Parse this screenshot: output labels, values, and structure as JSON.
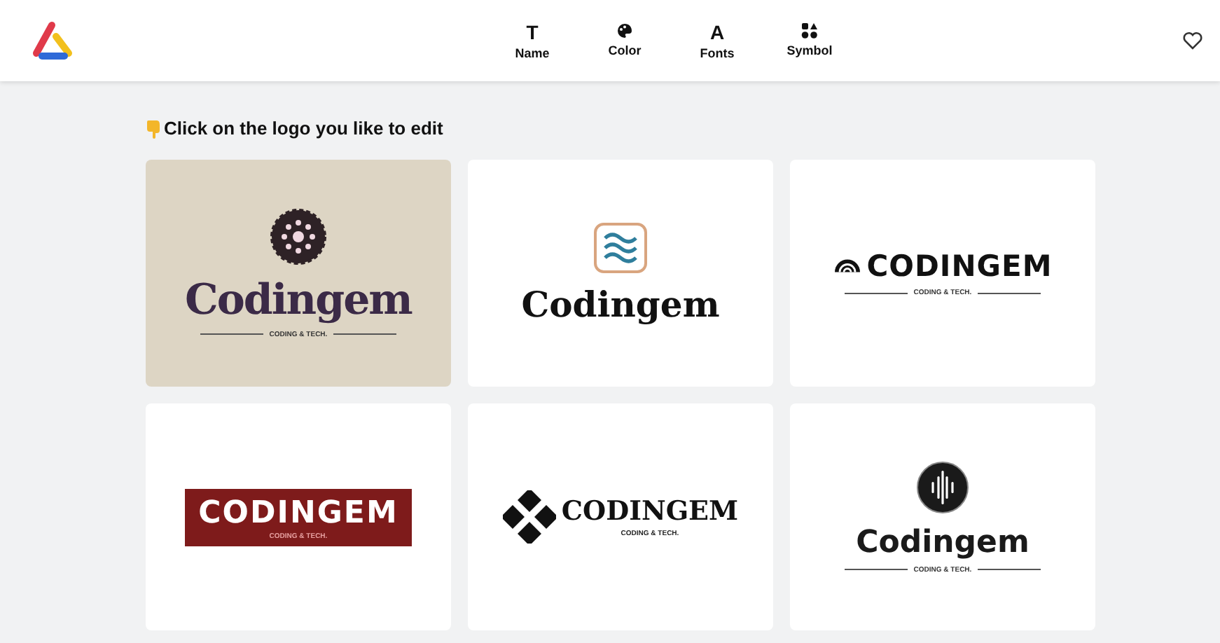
{
  "header": {
    "tools": [
      {
        "label": "Name",
        "kind": "glyph",
        "glyph": "T"
      },
      {
        "label": "Color",
        "kind": "palette"
      },
      {
        "label": "Fonts",
        "kind": "glyph",
        "glyph": "A"
      },
      {
        "label": "Symbol",
        "kind": "shapes"
      }
    ]
  },
  "instruction": "Click on the logo you like to edit",
  "logos": [
    {
      "kind": "badge",
      "name": "Codingem",
      "tagline": "CODING & TECH."
    },
    {
      "kind": "waves",
      "name": "Codingem"
    },
    {
      "kind": "signal",
      "name": "CODINGEM",
      "tagline": "CODING & TECH."
    },
    {
      "kind": "banner",
      "name": "CODINGEM",
      "tagline": "CODING & TECH."
    },
    {
      "kind": "diamonds",
      "name": "CODINGEM",
      "tagline": "CODING & TECH."
    },
    {
      "kind": "sound",
      "name": "Codingem",
      "tagline": "CODING & TECH."
    }
  ]
}
